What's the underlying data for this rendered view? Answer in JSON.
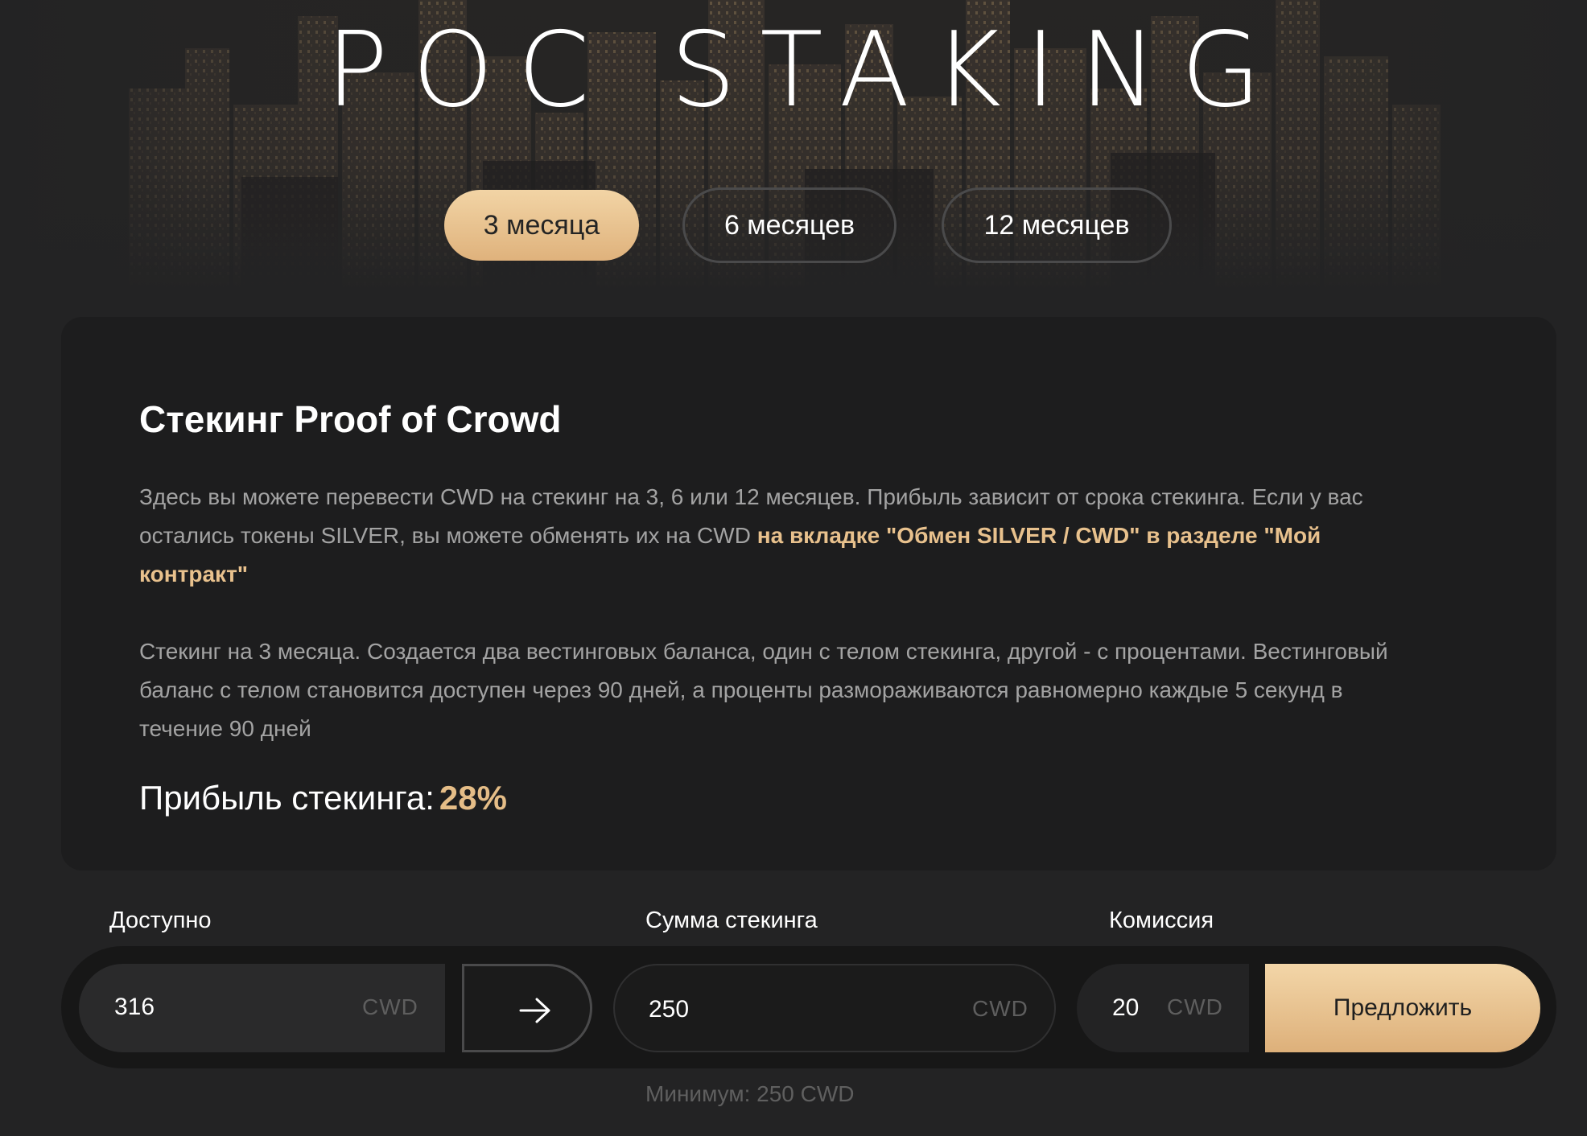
{
  "hero": {
    "title": "POC STAKING"
  },
  "tabs": [
    {
      "label": "3 месяца",
      "active": true
    },
    {
      "label": "6 месяцев",
      "active": false
    },
    {
      "label": "12 месяцев",
      "active": false
    }
  ],
  "card": {
    "title": "Стекинг Proof of Crowd",
    "intro_text": "Здесь вы можете перевести CWD на стекинг на 3, 6 или 12 месяцев. Прибыль зависит от срока стекинга. Если у вас остались токены SILVER, вы можете обменять их на CWD ",
    "intro_link": "на вкладке \"Обмен SILVER / CWD\" в разделе \"Мой контракт\"",
    "description": "Стекинг на 3 месяца. Создается два вестинговых баланса, один с телом стекинга, другой - с процентами. Вестинговый баланс с телом становится доступен через 90 дней, а проценты размораживаются равномерно каждые 5 секунд в течение 90 дней",
    "profit_label": "Прибыль стекинга:",
    "profit_value": "28%"
  },
  "form": {
    "available": {
      "label": "Доступно",
      "value": "316",
      "unit": "CWD"
    },
    "amount": {
      "label": "Сумма стекинга",
      "value": "250",
      "unit": "CWD"
    },
    "fee": {
      "label": "Комиссия",
      "value": "20",
      "unit": "CWD"
    },
    "submit_label": "Предложить",
    "min_note": "Минимум: 250 CWD"
  },
  "colors": {
    "background": "#232324",
    "card": "#1d1d1e",
    "accent": "#e5bd87",
    "muted_text": "#a3a3a3"
  },
  "icons": {
    "arrow": "arrow-right-icon"
  }
}
